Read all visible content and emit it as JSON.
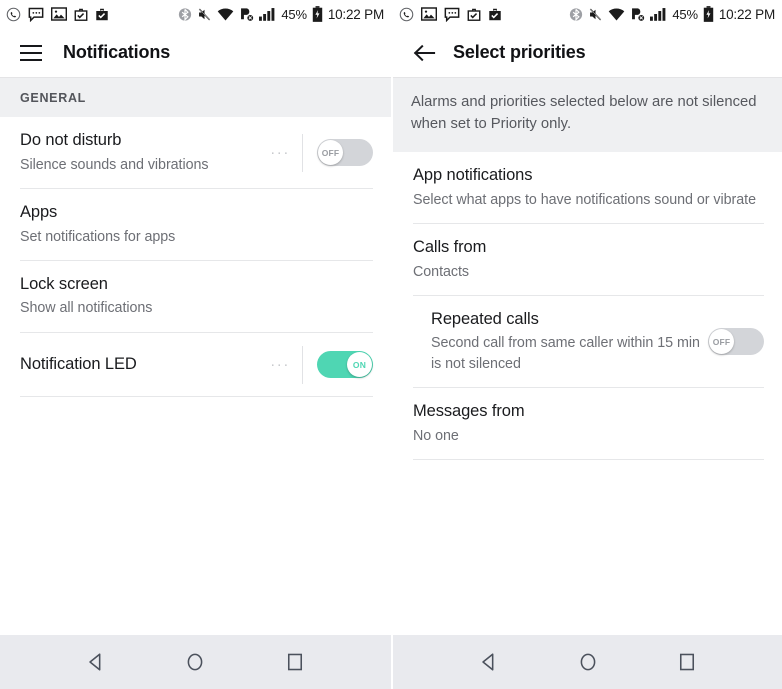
{
  "status_bar": {
    "left_icons": [
      "missed-call-icon",
      "message-bubble-icon",
      "image-icon",
      "briefcase-check-icon",
      "briefcase-check-filled-icon"
    ],
    "left_icons_right_panel": [
      "missed-call-icon",
      "image-icon",
      "message-bubble-icon",
      "briefcase-check-icon",
      "briefcase-check-filled-icon"
    ],
    "bluetooth_icon": "bluetooth-icon",
    "mute_icon": "volume-muted-icon",
    "wifi_icon": "wifi-icon",
    "data_off_icon": "mobile-data-off-icon",
    "signal_icon": "signal-bars-icon",
    "battery_percent": "45%",
    "battery_icon": "battery-charging-icon",
    "time": "10:22 PM"
  },
  "colors": {
    "toggle_on": "#4fd6b3",
    "toggle_off": "#d3d5d9",
    "section_bg": "#eff0f2",
    "navbar_bg": "#e9eaee",
    "title": "#1a1b1e",
    "subtitle": "#6d6f75"
  },
  "left_screen": {
    "menu_icon": "hamburger-menu-icon",
    "title": "Notifications",
    "section_label": "GENERAL",
    "rows": [
      {
        "title": "Do not disturb",
        "subtitle": "Silence sounds and vibrations",
        "has_ellipsis": true,
        "ellipsis": "···",
        "toggle": "OFF",
        "toggle_state": "off"
      },
      {
        "title": "Apps",
        "subtitle": "Set notifications for apps",
        "has_ellipsis": false,
        "toggle": null
      },
      {
        "title": "Lock screen",
        "subtitle": "Show all notifications",
        "has_ellipsis": false,
        "toggle": null
      },
      {
        "title": "Notification LED",
        "subtitle": "",
        "has_ellipsis": true,
        "ellipsis": "···",
        "toggle": "ON",
        "toggle_state": "on"
      }
    ]
  },
  "right_screen": {
    "back_icon": "back-arrow-icon",
    "title": "Select priorities",
    "banner": "Alarms and priorities selected below are not silenced when set to Priority only.",
    "rows": [
      {
        "title": "App notifications",
        "subtitle": "Select what apps to have notifications sound or vibrate",
        "indented": false,
        "toggle": null
      },
      {
        "title": "Calls from",
        "subtitle": "Contacts",
        "indented": false,
        "toggle": null
      },
      {
        "title": "Repeated calls",
        "subtitle": "Second call from same caller within 15 min is not silenced",
        "indented": true,
        "toggle": "OFF",
        "toggle_state": "off"
      },
      {
        "title": "Messages from",
        "subtitle": "No one",
        "indented": false,
        "toggle": null
      }
    ]
  },
  "nav_bar": {
    "back": "back-triangle-icon",
    "home": "home-circle-icon",
    "recents": "recents-square-icon"
  }
}
